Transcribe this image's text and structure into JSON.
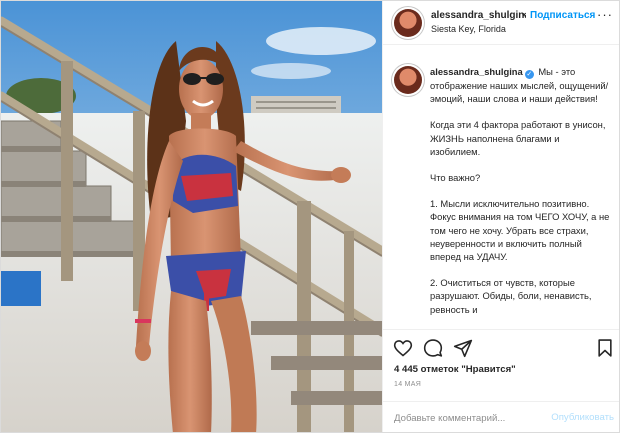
{
  "header": {
    "username": "alessandra_shulgina",
    "separator": "•",
    "follow_label": "Подписаться",
    "location": "Siesta Key, Florida",
    "more_label": "···"
  },
  "caption": {
    "username": "alessandra_shulgina",
    "paragraphs": [
      "Мы - это отображение наших мыслей, ощущений/эмоций, наши слова и наши действия!",
      "Когда эти 4 фактора работают в унисон, ЖИЗНЬ наполнена благами и изобилием.",
      "Что важно?",
      "1. Мысли исключительно позитивно. Фокус внимания на том ЧЕГО ХОЧУ, а не том чего не хочу. Убрать все страхи, неуверенности и включить полный вперед на УДАЧУ.",
      "2. Очиститься от чувств, которые разрушают. Обиды, боли, ненависть, ревность и"
    ]
  },
  "actions": {
    "like_icon": "heart-icon",
    "comment_icon": "comment-icon",
    "share_icon": "share-icon",
    "save_icon": "bookmark-icon"
  },
  "stats": {
    "likes": "4 445 отметок \"Нравится\"",
    "date": "14 МАЯ"
  },
  "comment": {
    "placeholder": "Добавьте комментарий...",
    "publish_label": "Опубликовать"
  },
  "colors": {
    "link": "#0095f6",
    "publish_disabled": "#b2dffc",
    "verified": "#3897f0"
  }
}
